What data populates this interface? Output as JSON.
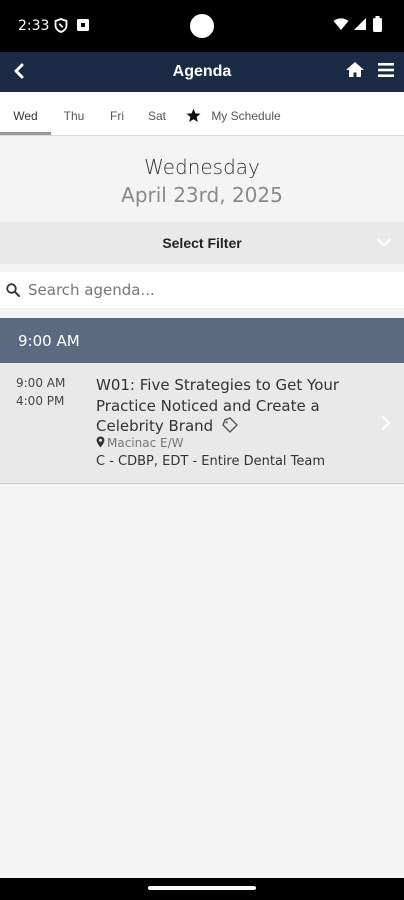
{
  "status_bar": {
    "time": "2:33",
    "icons": [
      "shield-icon",
      "app-notification-icon",
      "wifi-icon",
      "signal-icon",
      "battery-icon"
    ]
  },
  "app_bar": {
    "title": "Agenda",
    "background": "#1b2a45",
    "icons": [
      "back-arrow-icon",
      "home-icon",
      "menu-icon"
    ]
  },
  "tabs": [
    {
      "label": "Wed",
      "active": true
    },
    {
      "label": "Thu",
      "active": false
    },
    {
      "label": "Fri",
      "active": false
    },
    {
      "label": "Sat",
      "active": false
    },
    {
      "label": "My Schedule",
      "active": false,
      "icon": "star-icon"
    }
  ],
  "date_header": {
    "day": "Wednesday",
    "date": "April 23rd, 2025"
  },
  "filter": {
    "label": "Select Filter",
    "icon": "chevron-down-icon"
  },
  "search": {
    "placeholder": "Search agenda...",
    "value": ""
  },
  "time_groups": [
    {
      "time": "9:00 AM",
      "header_color": "#5b6a80",
      "sessions": [
        {
          "start": "9:00 AM",
          "end": "4:00 PM",
          "title": "W01: Five Strategies to Get Your Practice Noticed and Create a Celebrity Brand",
          "location": "Macinac E/W",
          "track": "C - CDBP, EDT - Entire Dental Team",
          "icons": [
            "tag-icon",
            "location-pin-icon",
            "chevron-right-icon"
          ]
        }
      ]
    }
  ]
}
